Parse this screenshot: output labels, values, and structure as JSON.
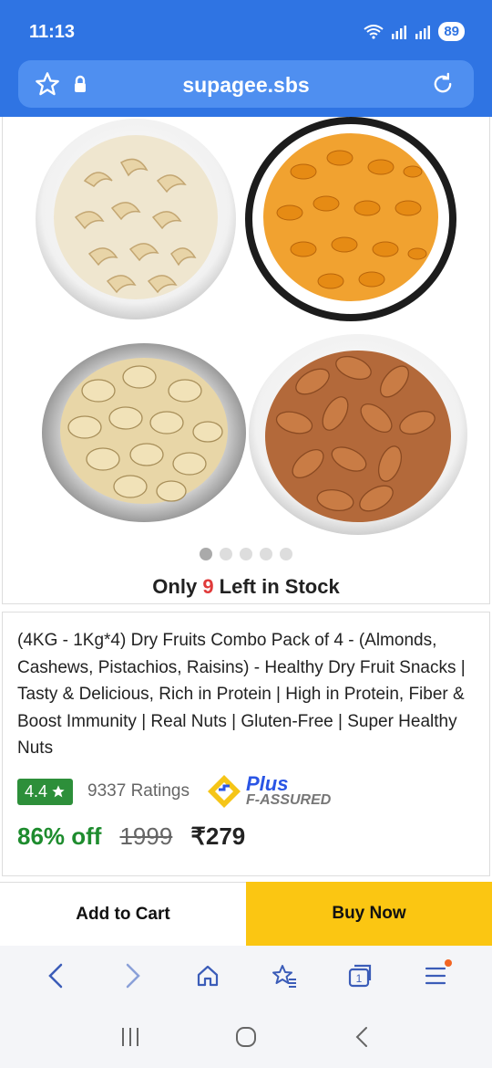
{
  "status_bar": {
    "time": "11:13",
    "battery": "89"
  },
  "browser": {
    "url": "supagee.sbs"
  },
  "product": {
    "stock_prefix": "Only ",
    "stock_count": "9",
    "stock_suffix": " Left in Stock",
    "carousel": {
      "total": 5,
      "active": 1
    },
    "title": "(4KG - 1Kg*4) Dry Fruits Combo Pack of 4 - (Almonds, Cashews, Pistachios, Raisins) - Healthy Dry Fruit Snacks | Tasty & Delicious, Rich in Protein | High in Protein, Fiber & Boost Immunity | Real Nuts | Gluten-Free | Super Healthy Nuts",
    "rating": "4.4",
    "ratings_count": "9337 Ratings",
    "plus_label": "Plus",
    "fassured_label": "F-ASSURED",
    "discount": "86% off",
    "mrp": "1999",
    "price": "₹279"
  },
  "cta": {
    "add_to_cart": "Add to Cart",
    "buy_now": "Buy Now"
  },
  "colors": {
    "status_blue": "#2f74e3",
    "buy_yellow": "#fbc612",
    "discount_green": "#1e8c2e",
    "rating_green": "#2d8f3a",
    "stock_red": "#e03a3a"
  },
  "icons": [
    "star-icon",
    "lock-icon",
    "reload-icon",
    "back-icon",
    "forward-icon",
    "home-icon",
    "bookmarks-icon",
    "tabs-icon",
    "menu-icon",
    "recents-icon",
    "home-button-icon",
    "back-button-icon"
  ]
}
